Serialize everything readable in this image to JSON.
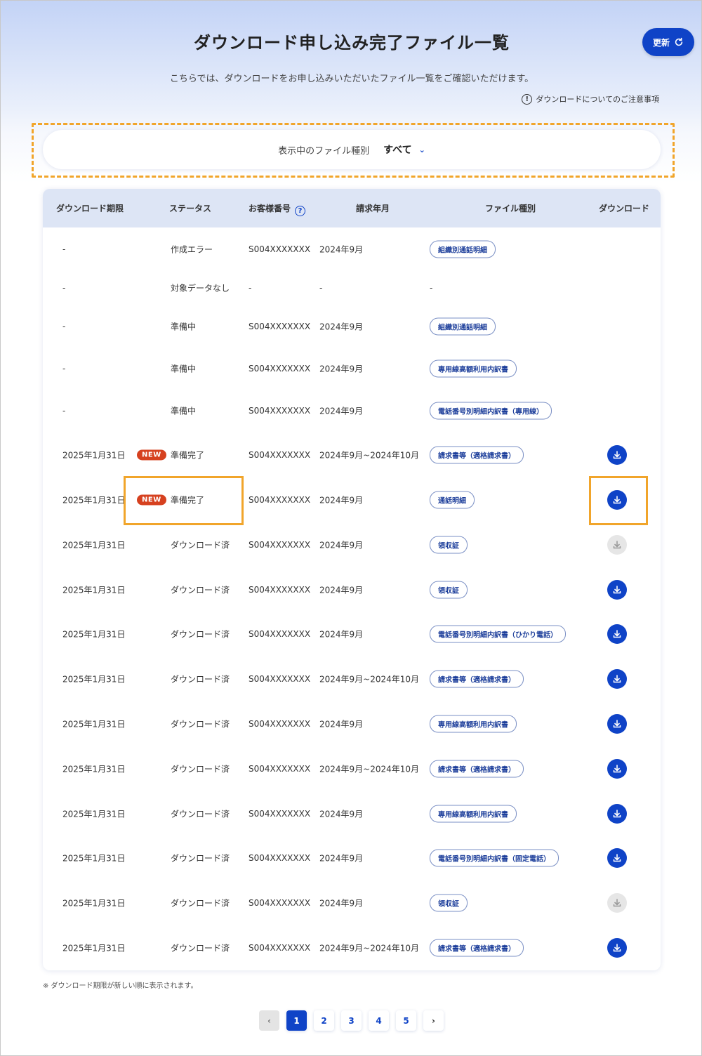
{
  "header": {
    "title": "ダウンロード申し込み完了ファイル一覧",
    "refresh_label": "更新",
    "lead": "こちらでは、ダウンロードをお申し込みいただいたファイル一覧をご確認いただけます。",
    "notice_link": "ダウンロードについてのご注意事項"
  },
  "filter": {
    "label": "表示中のファイル種別",
    "selected": "すべて"
  },
  "table": {
    "columns": {
      "deadline": "ダウンロード期限",
      "status": "ステータス",
      "customer_no": "お客様番号",
      "billing_month": "請求年月",
      "file_type": "ファイル種別",
      "download": "ダウンロード"
    },
    "rows": [
      {
        "deadline": "-",
        "new": "",
        "status": "作成エラー",
        "customer_no": "S004XXXXXXX",
        "billing_month": "2024年9月",
        "file_type": "組織別通話明細",
        "download": "none"
      },
      {
        "deadline": "-",
        "new": "",
        "status": "対象データなし",
        "customer_no": "-",
        "billing_month": "-",
        "file_type": "-",
        "download": "none"
      },
      {
        "deadline": "-",
        "new": "",
        "status": "準備中",
        "customer_no": "S004XXXXXXX",
        "billing_month": "2024年9月",
        "file_type": "組織別通話明細",
        "download": "none"
      },
      {
        "deadline": "-",
        "new": "",
        "status": "準備中",
        "customer_no": "S004XXXXXXX",
        "billing_month": "2024年9月",
        "file_type": "専用線高額利用内訳書",
        "download": "none"
      },
      {
        "deadline": "-",
        "new": "",
        "status": "準備中",
        "customer_no": "S004XXXXXXX",
        "billing_month": "2024年9月",
        "file_type": "電話番号別明細内訳書（専用線）",
        "download": "none"
      },
      {
        "deadline": "2025年1月31日",
        "new": "NEW",
        "status": "準備完了",
        "customer_no": "S004XXXXXXX",
        "billing_month": "2024年9月~2024年10月",
        "file_type": "請求書等（適格請求書）",
        "download": "active"
      },
      {
        "deadline": "2025年1月31日",
        "new": "NEW",
        "status": "準備完了",
        "customer_no": "S004XXXXXXX",
        "billing_month": "2024年9月",
        "file_type": "通話明細",
        "download": "active"
      },
      {
        "deadline": "2025年1月31日",
        "new": "",
        "status": "ダウンロード済",
        "customer_no": "S004XXXXXXX",
        "billing_month": "2024年9月",
        "file_type": "領収証",
        "download": "disabled"
      },
      {
        "deadline": "2025年1月31日",
        "new": "",
        "status": "ダウンロード済",
        "customer_no": "S004XXXXXXX",
        "billing_month": "2024年9月",
        "file_type": "領収証",
        "download": "active"
      },
      {
        "deadline": "2025年1月31日",
        "new": "",
        "status": "ダウンロード済",
        "customer_no": "S004XXXXXXX",
        "billing_month": "2024年9月",
        "file_type": "電話番号別明細内訳書（ひかり電話）",
        "download": "active"
      },
      {
        "deadline": "2025年1月31日",
        "new": "",
        "status": "ダウンロード済",
        "customer_no": "S004XXXXXXX",
        "billing_month": "2024年9月~2024年10月",
        "file_type": "請求書等（適格請求書）",
        "download": "active"
      },
      {
        "deadline": "2025年1月31日",
        "new": "",
        "status": "ダウンロード済",
        "customer_no": "S004XXXXXXX",
        "billing_month": "2024年9月",
        "file_type": "専用線高額利用内訳書",
        "download": "active"
      },
      {
        "deadline": "2025年1月31日",
        "new": "",
        "status": "ダウンロード済",
        "customer_no": "S004XXXXXXX",
        "billing_month": "2024年9月~2024年10月",
        "file_type": "請求書等（適格請求書）",
        "download": "active"
      },
      {
        "deadline": "2025年1月31日",
        "new": "",
        "status": "ダウンロード済",
        "customer_no": "S004XXXXXXX",
        "billing_month": "2024年9月",
        "file_type": "専用線高額利用内訳書",
        "download": "active"
      },
      {
        "deadline": "2025年1月31日",
        "new": "",
        "status": "ダウンロード済",
        "customer_no": "S004XXXXXXX",
        "billing_month": "2024年9月",
        "file_type": "電話番号別明細内訳書（固定電話）",
        "download": "active"
      },
      {
        "deadline": "2025年1月31日",
        "new": "",
        "status": "ダウンロード済",
        "customer_no": "S004XXXXXXX",
        "billing_month": "2024年9月",
        "file_type": "領収証",
        "download": "disabled"
      },
      {
        "deadline": "2025年1月31日",
        "new": "",
        "status": "ダウンロード済",
        "customer_no": "S004XXXXXXX",
        "billing_month": "2024年9月~2024年10月",
        "file_type": "請求書等（適格請求書）",
        "download": "active"
      }
    ]
  },
  "footnote": "※ ダウンロード期限が新しい順に表示されます。",
  "pagination": {
    "pages": [
      "1",
      "2",
      "3",
      "4",
      "5"
    ],
    "current": "1"
  },
  "colors": {
    "primary": "#0f43c7",
    "badge_new": "#d6411f",
    "highlight": "#f1a52b",
    "header_row": "#dde5f5"
  },
  "icons": {
    "refresh": "refresh-icon",
    "info": "info-icon",
    "help": "help-icon",
    "download": "download-icon",
    "chevron_down": "chevron-down-icon",
    "chevron_left": "chevron-left-icon",
    "chevron_right": "chevron-right-icon"
  }
}
